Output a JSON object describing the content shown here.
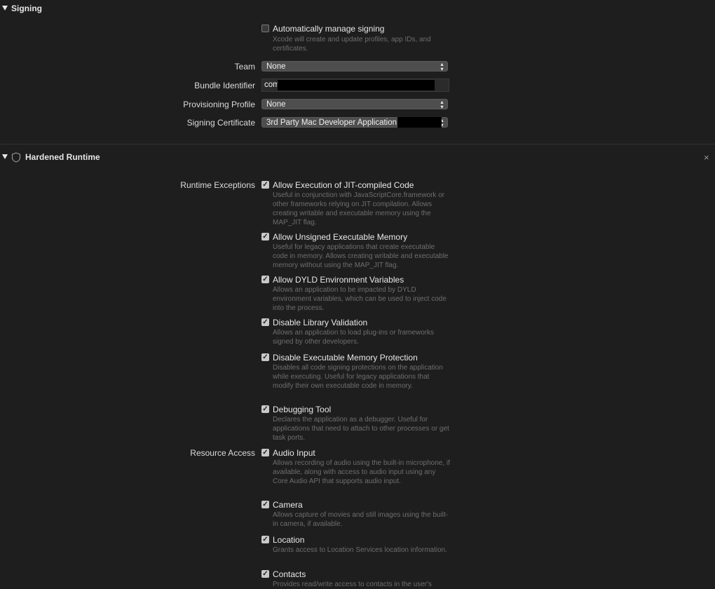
{
  "signing": {
    "title": "Signing",
    "auto_manage_label": "Automatically manage signing",
    "auto_manage_desc": "Xcode will create and update profiles, app IDs, and certificates.",
    "team_label": "Team",
    "team_value": "None",
    "bundle_label": "Bundle Identifier",
    "bundle_value": "com",
    "profile_label": "Provisioning Profile",
    "profile_value": "None",
    "certificate_label": "Signing Certificate",
    "certificate_value": "3rd Party Mac Developer Application"
  },
  "hardened": {
    "title": "Hardened Runtime",
    "close_glyph": "×",
    "runtime_exceptions_label": "Runtime Exceptions",
    "resource_access_label": "Resource Access",
    "options": [
      {
        "title": "Allow Execution of JIT-compiled Code",
        "desc": "Useful in conjunction with JavaScriptCore.framework or other frameworks relying on JIT compilation. Allows creating writable and executable memory using the MAP_JIT flag."
      },
      {
        "title": "Allow Unsigned Executable Memory",
        "desc": "Useful for legacy applications that create executable code in memory. Allows creating writable and executable memory without using the MAP_JIT flag."
      },
      {
        "title": "Allow DYLD Environment Variables",
        "desc": "Allows an application to be impacted by DYLD environment variables, which can be used to inject code into the process."
      },
      {
        "title": "Disable Library Validation",
        "desc": "Allows an application to load plug-ins or frameworks signed by other developers."
      },
      {
        "title": "Disable Executable Memory Protection",
        "desc": "Disables all code signing protections on the application while executing. Useful for legacy applications that modify their own executable code in memory."
      },
      {
        "title": "Debugging Tool",
        "desc": "Declares the application as a debugger. Useful for applications that need to attach to other processes or get task ports."
      },
      {
        "title": "Audio Input",
        "desc": "Allows recording of audio using the built-in microphone, if available, along with access to audio input using any Core Audio API that supports audio input."
      },
      {
        "title": "Camera",
        "desc": "Allows capture of movies and still images using the built-in camera, if available."
      },
      {
        "title": "Location",
        "desc": "Grants access to Location Services location information."
      },
      {
        "title": "Contacts",
        "desc": "Provides read/write access to contacts in the user's"
      }
    ]
  },
  "check_glyph": "✓",
  "chevron_up": "▴",
  "chevron_down": "▾"
}
